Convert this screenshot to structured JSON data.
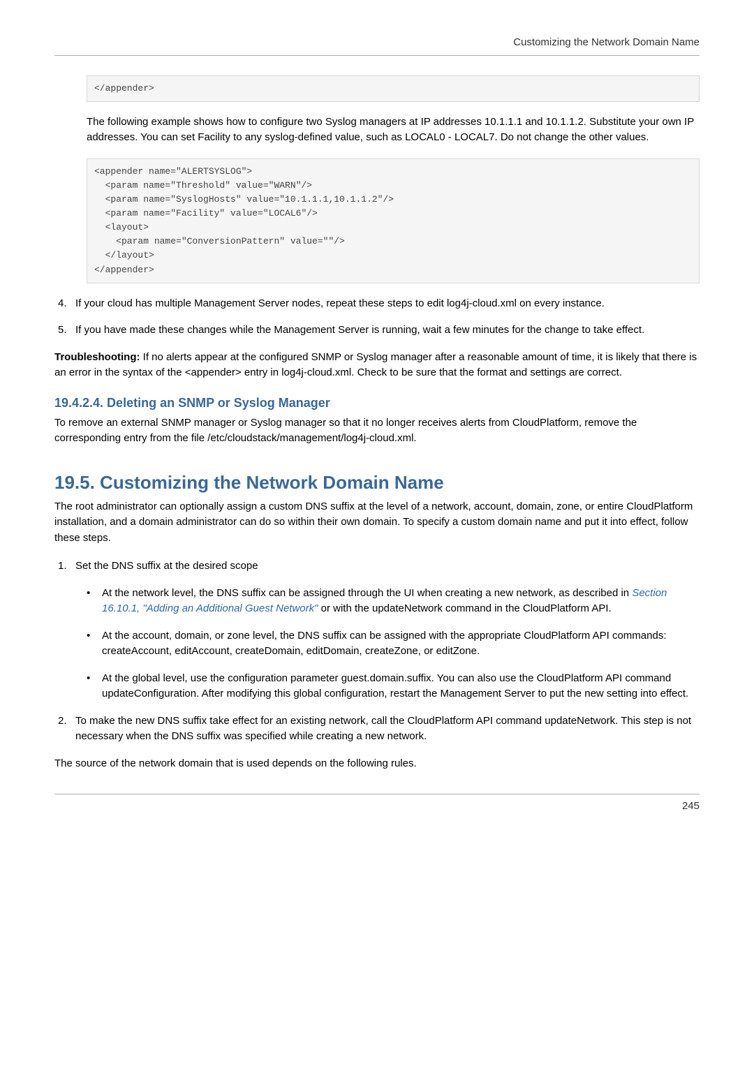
{
  "header": {
    "running": "Customizing the Network Domain Name"
  },
  "code1": "</appender>",
  "para_intro": "The following example shows how to configure two Syslog managers at IP addresses 10.1.1.1 and 10.1.1.2. Substitute your own IP addresses. You can set Facility to any syslog-defined value, such as LOCAL0 - LOCAL7. Do not change the other values.",
  "code2": "<appender name=\"ALERTSYSLOG\">\n  <param name=\"Threshold\" value=\"WARN\"/>\n  <param name=\"SyslogHosts\" value=\"10.1.1.1,10.1.1.2\"/>\n  <param name=\"Facility\" value=\"LOCAL6\"/>\n  <layout>\n    <param name=\"ConversionPattern\" value=\"\"/>\n  </layout>\n</appender>",
  "step4": {
    "num": "4.",
    "text": "If your cloud has multiple Management Server nodes, repeat these steps to edit log4j-cloud.xml on every instance."
  },
  "step5": {
    "num": "5.",
    "text": "If you have made these changes while the Management Server is running, wait a few minutes for the change to take effect."
  },
  "trouble_label": "Troubleshooting:",
  "trouble_text": " If no alerts appear at the configured SNMP or Syslog manager after a reasonable amount of time, it is likely that there is an error in the syntax of the <appender> entry in log4j-cloud.xml. Check to be sure that the format and settings are correct.",
  "h3_delete": "19.4.2.4. Deleting an SNMP or Syslog Manager",
  "para_delete": "To remove an external SNMP manager or Syslog manager so that it no longer receives alerts from CloudPlatform, remove the corresponding entry from the file /etc/cloudstack/management/log4j-cloud.xml.",
  "h2_custom": "19.5. Customizing the Network Domain Name",
  "para_custom": "The root administrator can optionally assign a custom DNS suffix at the level of a network, account, domain, zone, or entire CloudPlatform installation, and a domain administrator can do so within their own domain. To specify a custom domain name and put it into effect, follow these steps.",
  "cstep1": {
    "num": "1.",
    "text": "Set the DNS suffix at the desired scope"
  },
  "b1_a": "At the network level, the DNS suffix can be assigned through the UI when creating a new network, as described in ",
  "b1_link": "Section 16.10.1, \"Adding an Additional Guest Network\"",
  "b1_b": " or with the updateNetwork command in the CloudPlatform API.",
  "b2": "At the account, domain, or zone level, the DNS suffix can be assigned with the appropriate CloudPlatform API commands: createAccount, editAccount, createDomain, editDomain, createZone, or editZone.",
  "b3": "At the global level, use the configuration parameter guest.domain.suffix. You can also use the CloudPlatform API command updateConfiguration. After modifying this global configuration, restart the Management Server to put the new setting into effect.",
  "cstep2": {
    "num": "2.",
    "text": "To make the new DNS suffix take effect for an existing network, call the CloudPlatform API command updateNetwork. This step is not necessary when the DNS suffix was specified while creating a new network."
  },
  "para_rules": "The source of the network domain that is used depends on the following rules.",
  "footer": {
    "page": "245"
  }
}
